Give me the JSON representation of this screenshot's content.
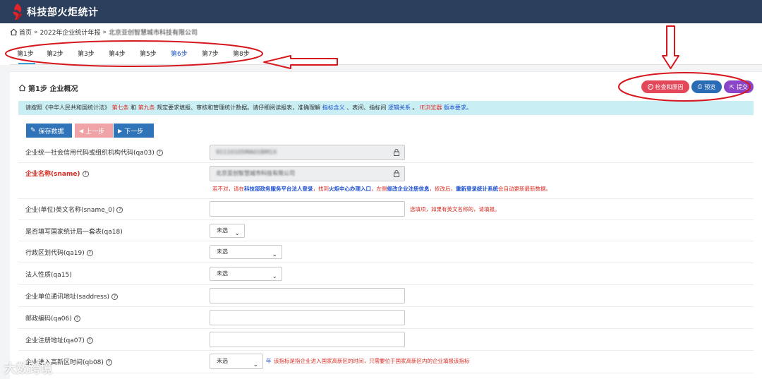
{
  "app": {
    "title": "科技部火炬统计"
  },
  "breadcrumb": {
    "items": [
      "首页",
      "2022年企业统计年报",
      "北京亚创智慧城市科技有限公司"
    ]
  },
  "steps": [
    "第1步",
    "第2步",
    "第3步",
    "第4步",
    "第5步",
    "第6步",
    "第7步",
    "第8步"
  ],
  "section": {
    "title": "第1步 企业概况"
  },
  "top_buttons": {
    "check": "检查和原因",
    "preview": "预览",
    "submit": "提交"
  },
  "notice": {
    "p1": "请按照《中华人民共和国统计法》",
    "p2": "第七条",
    "p3": "和",
    "p4": "第九条",
    "p5": "规定要求填报、审核和管理统计数据。请仔细阅读报表，准确理解",
    "p6": "指标含义",
    "p7": "、表间、指标间",
    "p8": "逻辑关系",
    "p9": "。",
    "p10": "IE浏览器",
    "p11": "版本要求。"
  },
  "nav_buttons": {
    "save": "保存数据",
    "prev": "上一步",
    "next": "下一步"
  },
  "form": {
    "credit_code": {
      "label": "企业统一社会信用代码或组织机构代码(qa03)",
      "value": "91110105MA01BM1X"
    },
    "sname": {
      "label": "企业名称(sname)",
      "value": "北京亚创智慧城市科技有限公司"
    },
    "sname_hint": {
      "a": "若不对，请在",
      "b": "科技部政务服务平台法人登录",
      "c": "，找到",
      "d": "火炬中心办理入口",
      "e": "，左侧",
      "f": "修改企业注册信息",
      "g": "，修改后，",
      "h": "重新登录统计系统",
      "i": "会自动更新最新数据。"
    },
    "sname_0": {
      "label": "企业(单位)英文名称(sname_0)",
      "value": "",
      "hint": "选填项，如果有英文名称的，请填报。"
    },
    "qa18": {
      "label": "是否填写国家统计局一套表(qa18)",
      "value": "未选"
    },
    "qa19": {
      "label": "行政区划代码(qa19)",
      "value": "未选"
    },
    "qa15": {
      "label": "法人性质(qa15)",
      "value": "未选"
    },
    "saddress": {
      "label": "企业单位通讯地址(saddress)",
      "value": ""
    },
    "qa06": {
      "label": "邮政编码(qa06)",
      "value": ""
    },
    "qa07": {
      "label": "企业注册地址(qa07)",
      "value": ""
    },
    "qb08": {
      "label": "企业进入高新区时间(qb08)",
      "value": "未选",
      "unit": "年",
      "hint": "该指标是指企业进入国家高新区的时间，只需要位于国家高新区内的企业填报该指标"
    }
  },
  "watermark": "大数跨境",
  "colors": {
    "topbar": "#2b3e5b",
    "save": "#2f73b8",
    "prev": "#f0a3a6",
    "next": "#2f73b8",
    "check": "#e2485a",
    "preview": "#2a6bb5",
    "submit": "#8b46c7",
    "annotation": "#d6171d"
  }
}
